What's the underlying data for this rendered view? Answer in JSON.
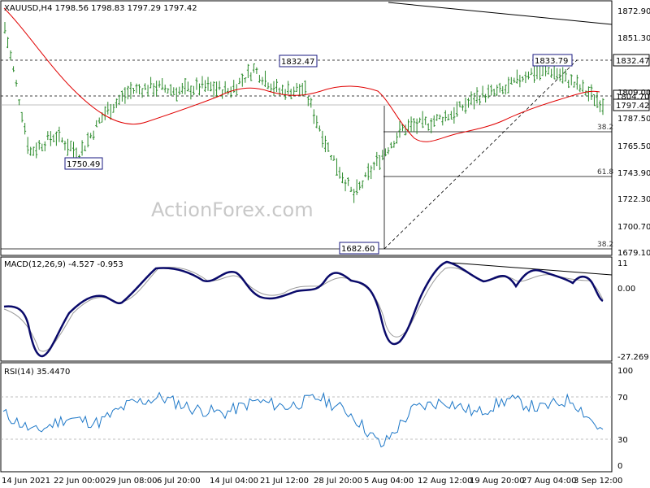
{
  "watermark": "ActionForex.com",
  "price_panel": {
    "header": "XAUUSD,H4  1798.56 1798.83 1797.29 1797.42",
    "y_ticks": [
      "1872.90",
      "1851.30",
      "1809.00",
      "1787.50",
      "1765.50",
      "1743.90",
      "1722.30",
      "1700.70",
      "1679.10"
    ],
    "tag_1832": "1832.47",
    "tag_1804": "1804.70",
    "tag_last": "1797.42",
    "label_high1": "1832.47",
    "label_high2": "1833.79",
    "label_low1": "1750.49",
    "label_low2": "1682.60",
    "fib_382_top": "38.2",
    "fib_618": "61.8",
    "fib_382_bottom": "38.2"
  },
  "macd_panel": {
    "header": "MACD(12,26,9) -4.527 -0.953",
    "y_ticks": [
      "11",
      "0.00",
      "-27.269"
    ]
  },
  "rsi_panel": {
    "header": "RSI(14) 35.4470",
    "y_ticks": [
      "100",
      "70",
      "30",
      "0"
    ]
  },
  "x_labels": [
    "14 Jun 2021",
    "22 Jun 00:00",
    "29 Jun 08:00",
    "6 Jul 20:00",
    "14 Jul 04:00",
    "21 Jul 12:00",
    "28 Jul 20:00",
    "5 Aug 04:00",
    "12 Aug 12:00",
    "19 Aug 20:00",
    "27 Aug 04:00",
    "3 Sep 12:00"
  ],
  "chart_data": [
    {
      "type": "line",
      "title": "XAUUSD,H4  1798.56 1798.83 1797.29 1797.42",
      "x": [
        "14 Jun 2021",
        "22 Jun 00:00",
        "29 Jun 08:00",
        "6 Jul 20:00",
        "14 Jul 04:00",
        "21 Jul 12:00",
        "28 Jul 20:00",
        "5 Aug 04:00",
        "12 Aug 12:00",
        "19 Aug 20:00",
        "27 Aug 04:00",
        "3 Sep 12:00"
      ],
      "ylim": [
        1675,
        1880
      ],
      "series": [
        {
          "values": [
            1860,
            1758,
            1772,
            1757,
            1790,
            1808,
            1812,
            1808,
            1812,
            1808,
            1826,
            1808,
            1810,
            1760,
            1722,
            1752,
            1778,
            1782,
            1790,
            1804,
            1808,
            1823,
            1825,
            1812,
            1798
          ]
        }
      ],
      "annotations": [
        "1832.47",
        "1833.79",
        "1750.49",
        "1682.60",
        "38.2",
        "61.8",
        "38.2",
        "1804.70",
        "1797.42"
      ]
    },
    {
      "type": "line",
      "title": "MACD(12,26,9) -4.527 -0.953",
      "ylim": [
        -27.269,
        11
      ],
      "series": [
        {
          "values": [
            -2,
            -25,
            -15,
            -5,
            6,
            3,
            5,
            -1,
            -3,
            3,
            -2,
            -20,
            -5,
            9,
            5,
            2,
            8,
            4,
            -5
          ]
        }
      ]
    },
    {
      "type": "line",
      "title": "RSI(14) 35.4470",
      "ylim": [
        0,
        100
      ],
      "series": [
        {
          "values": [
            55,
            35,
            50,
            45,
            65,
            72,
            60,
            55,
            68,
            62,
            72,
            55,
            20,
            60,
            68,
            55,
            70,
            60,
            70,
            35
          ]
        }
      ]
    }
  ]
}
